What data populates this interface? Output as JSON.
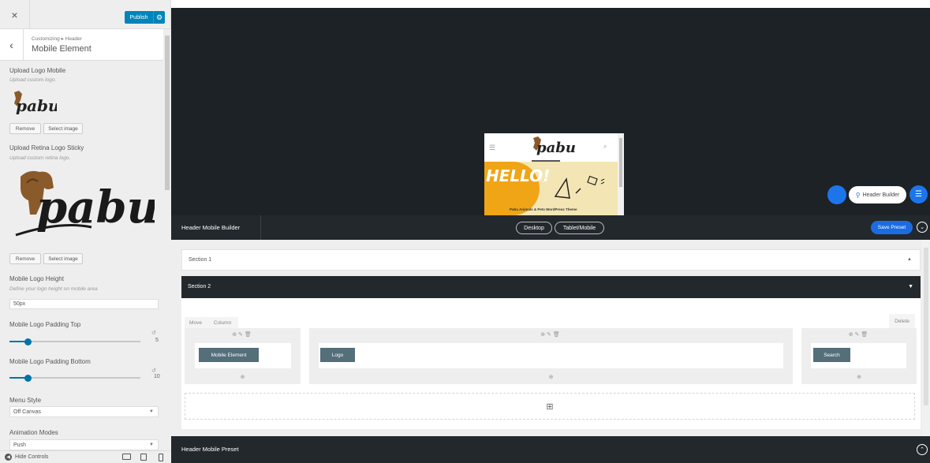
{
  "panel": {
    "close_glyph": "×",
    "publish_label": "Publish",
    "breadcrumb": "Customizing ▸ Header",
    "title": "Mobile Element",
    "upload_logo": {
      "label": "Upload Logo Mobile",
      "desc": "Upload custom logo.",
      "remove": "Remove",
      "select": "Select image"
    },
    "upload_retina": {
      "label": "Upload Retina Logo Sticky",
      "desc": "Upload custom retina logo.",
      "remove": "Remove",
      "select": "Select image"
    },
    "logo_height": {
      "label": "Mobile Logo Height",
      "desc": "Define your logo height on mobile area",
      "value": "50px"
    },
    "padding_top": {
      "label": "Mobile Logo Padding Top",
      "value": "5",
      "level": 0.14
    },
    "padding_bottom": {
      "label": "Mobile Logo Padding Bottom",
      "value": "10",
      "level": 0.14
    },
    "menu_style": {
      "label": "Menu Style",
      "value": "Off Canvas"
    },
    "animation": {
      "label": "Animation Modes",
      "value": "Push"
    },
    "hide_controls": "Hide Controls"
  },
  "logo_text": "pabu",
  "preview": {
    "hello_text": "HELLO!",
    "tagline": "Pabu Animals & Pets WordPress Theme",
    "header_builder_label": "Header Builder"
  },
  "builder": {
    "title": "Header Mobile Builder",
    "desktop_label": "Desktop",
    "tablet_label": "Tablet/Mobile",
    "save_preset_label": "Save Preset",
    "section1_label": "Section 1",
    "section2_label": "Section 2",
    "move_label": "Move",
    "column_label": "Column",
    "delete_label": "Delete",
    "columns": [
      {
        "chip": "Mobile Element"
      },
      {
        "chip": "Logo"
      },
      {
        "chip": "Search"
      }
    ],
    "preset_title": "Header Mobile Preset"
  },
  "colors": {
    "accent": "#0085ba",
    "dark": "#23282d",
    "save_blue": "#1b6ce0",
    "chip": "#546e7a"
  }
}
